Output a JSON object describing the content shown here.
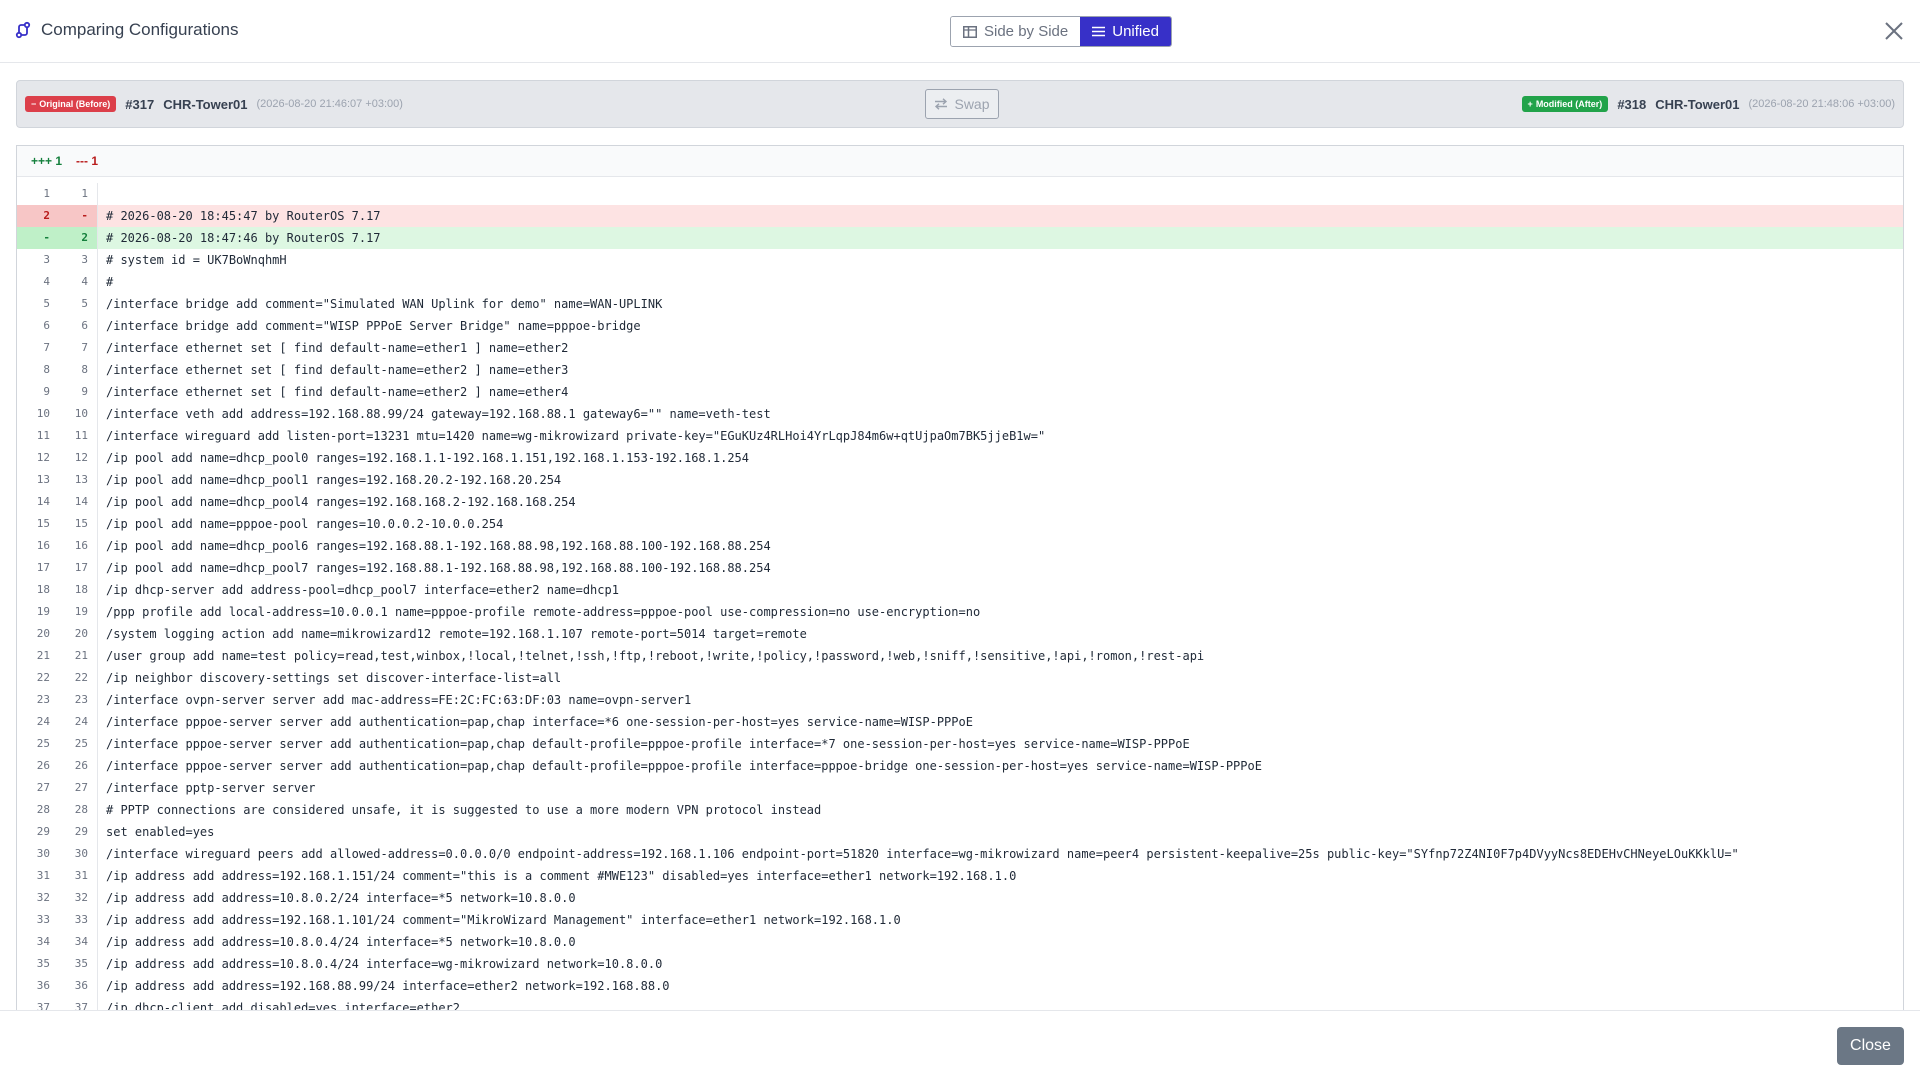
{
  "header": {
    "title": "Comparing Configurations",
    "view_toggle": {
      "side_by_side_label": "Side by Side",
      "unified_label": "Unified",
      "selected": "Unified"
    }
  },
  "compare": {
    "original": {
      "badge": "Original (Before)",
      "revision": "#317",
      "device": "CHR-Tower01",
      "timestamp": "(2026-08-20 21:46:07 +03:00)"
    },
    "modified": {
      "badge": "Modified (After)",
      "revision": "#318",
      "device": "CHR-Tower01",
      "timestamp": "(2026-08-20 21:48:06 +03:00)"
    },
    "swap_label": "Swap"
  },
  "diff": {
    "additions": "+++ 1",
    "deletions": "--- 1",
    "lines": [
      {
        "old": "1",
        "new": "1",
        "type": "ctx",
        "text": ""
      },
      {
        "old": "2",
        "new": "-",
        "type": "del",
        "text": "# 2026-08-20 18:45:47 by RouterOS 7.17"
      },
      {
        "old": "-",
        "new": "2",
        "type": "add",
        "text": "# 2026-08-20 18:47:46 by RouterOS 7.17"
      },
      {
        "old": "3",
        "new": "3",
        "type": "ctx",
        "text": "# system id = UK7BoWnqhmH"
      },
      {
        "old": "4",
        "new": "4",
        "type": "ctx",
        "text": "#"
      },
      {
        "old": "5",
        "new": "5",
        "type": "ctx",
        "text": "/interface bridge add comment=\"Simulated WAN Uplink for demo\" name=WAN-UPLINK"
      },
      {
        "old": "6",
        "new": "6",
        "type": "ctx",
        "text": "/interface bridge add comment=\"WISP PPPoE Server Bridge\" name=pppoe-bridge"
      },
      {
        "old": "7",
        "new": "7",
        "type": "ctx",
        "text": "/interface ethernet set [ find default-name=ether1 ] name=ether2"
      },
      {
        "old": "8",
        "new": "8",
        "type": "ctx",
        "text": "/interface ethernet set [ find default-name=ether2 ] name=ether3"
      },
      {
        "old": "9",
        "new": "9",
        "type": "ctx",
        "text": "/interface ethernet set [ find default-name=ether2 ] name=ether4"
      },
      {
        "old": "10",
        "new": "10",
        "type": "ctx",
        "text": "/interface veth add address=192.168.88.99/24 gateway=192.168.88.1 gateway6=\"\" name=veth-test"
      },
      {
        "old": "11",
        "new": "11",
        "type": "ctx",
        "text": "/interface wireguard add listen-port=13231 mtu=1420 name=wg-mikrowizard private-key=\"EGuKUz4RLHoi4YrLqpJ84m6w+qtUjpaOm7BK5jjeB1w=\""
      },
      {
        "old": "12",
        "new": "12",
        "type": "ctx",
        "text": "/ip pool add name=dhcp_pool0 ranges=192.168.1.1-192.168.1.151,192.168.1.153-192.168.1.254"
      },
      {
        "old": "13",
        "new": "13",
        "type": "ctx",
        "text": "/ip pool add name=dhcp_pool1 ranges=192.168.20.2-192.168.20.254"
      },
      {
        "old": "14",
        "new": "14",
        "type": "ctx",
        "text": "/ip pool add name=dhcp_pool4 ranges=192.168.168.2-192.168.168.254"
      },
      {
        "old": "15",
        "new": "15",
        "type": "ctx",
        "text": "/ip pool add name=pppoe-pool ranges=10.0.0.2-10.0.0.254"
      },
      {
        "old": "16",
        "new": "16",
        "type": "ctx",
        "text": "/ip pool add name=dhcp_pool6 ranges=192.168.88.1-192.168.88.98,192.168.88.100-192.168.88.254"
      },
      {
        "old": "17",
        "new": "17",
        "type": "ctx",
        "text": "/ip pool add name=dhcp_pool7 ranges=192.168.88.1-192.168.88.98,192.168.88.100-192.168.88.254"
      },
      {
        "old": "18",
        "new": "18",
        "type": "ctx",
        "text": "/ip dhcp-server add address-pool=dhcp_pool7 interface=ether2 name=dhcp1"
      },
      {
        "old": "19",
        "new": "19",
        "type": "ctx",
        "text": "/ppp profile add local-address=10.0.0.1 name=pppoe-profile remote-address=pppoe-pool use-compression=no use-encryption=no"
      },
      {
        "old": "20",
        "new": "20",
        "type": "ctx",
        "text": "/system logging action add name=mikrowizard12 remote=192.168.1.107 remote-port=5014 target=remote"
      },
      {
        "old": "21",
        "new": "21",
        "type": "ctx",
        "text": "/user group add name=test policy=read,test,winbox,!local,!telnet,!ssh,!ftp,!reboot,!write,!policy,!password,!web,!sniff,!sensitive,!api,!romon,!rest-api"
      },
      {
        "old": "22",
        "new": "22",
        "type": "ctx",
        "text": "/ip neighbor discovery-settings set discover-interface-list=all"
      },
      {
        "old": "23",
        "new": "23",
        "type": "ctx",
        "text": "/interface ovpn-server server add mac-address=FE:2C:FC:63:DF:03 name=ovpn-server1"
      },
      {
        "old": "24",
        "new": "24",
        "type": "ctx",
        "text": "/interface pppoe-server server add authentication=pap,chap interface=*6 one-session-per-host=yes service-name=WISP-PPPoE"
      },
      {
        "old": "25",
        "new": "25",
        "type": "ctx",
        "text": "/interface pppoe-server server add authentication=pap,chap default-profile=pppoe-profile interface=*7 one-session-per-host=yes service-name=WISP-PPPoE"
      },
      {
        "old": "26",
        "new": "26",
        "type": "ctx",
        "text": "/interface pppoe-server server add authentication=pap,chap default-profile=pppoe-profile interface=pppoe-bridge one-session-per-host=yes service-name=WISP-PPPoE"
      },
      {
        "old": "27",
        "new": "27",
        "type": "ctx",
        "text": "/interface pptp-server server"
      },
      {
        "old": "28",
        "new": "28",
        "type": "ctx",
        "text": "# PPTP connections are considered unsafe, it is suggested to use a more modern VPN protocol instead"
      },
      {
        "old": "29",
        "new": "29",
        "type": "ctx",
        "text": "set enabled=yes"
      },
      {
        "old": "30",
        "new": "30",
        "type": "ctx",
        "text": "/interface wireguard peers add allowed-address=0.0.0.0/0 endpoint-address=192.168.1.106 endpoint-port=51820 interface=wg-mikrowizard name=peer4 persistent-keepalive=25s public-key=\"SYfnp72Z4NI0F7p4DVyyNcs8EDEHvCHNeyeLOuKKklU=\""
      },
      {
        "old": "31",
        "new": "31",
        "type": "ctx",
        "text": "/ip address add address=192.168.1.151/24 comment=\"this is a comment #MWE123\" disabled=yes interface=ether1 network=192.168.1.0"
      },
      {
        "old": "32",
        "new": "32",
        "type": "ctx",
        "text": "/ip address add address=10.8.0.2/24 interface=*5 network=10.8.0.0"
      },
      {
        "old": "33",
        "new": "33",
        "type": "ctx",
        "text": "/ip address add address=192.168.1.101/24 comment=\"MikroWizard Management\" interface=ether1 network=192.168.1.0"
      },
      {
        "old": "34",
        "new": "34",
        "type": "ctx",
        "text": "/ip address add address=10.8.0.4/24 interface=*5 network=10.8.0.0"
      },
      {
        "old": "35",
        "new": "35",
        "type": "ctx",
        "text": "/ip address add address=10.8.0.4/24 interface=wg-mikrowizard network=10.8.0.0"
      },
      {
        "old": "36",
        "new": "36",
        "type": "ctx",
        "text": "/ip address add address=192.168.88.99/24 interface=ether2 network=192.168.88.0"
      },
      {
        "old": "37",
        "new": "37",
        "type": "ctx",
        "text": "/ip dhcp-client add disabled=yes interface=ether2"
      }
    ]
  },
  "footer": {
    "close_label": "Close"
  },
  "colors": {
    "accent": "#3730c8",
    "deleted_bg": "#fde3e3",
    "added_bg": "#ddf7e2",
    "badge_original": "#dc3f4a",
    "badge_modified": "#22a34a"
  }
}
